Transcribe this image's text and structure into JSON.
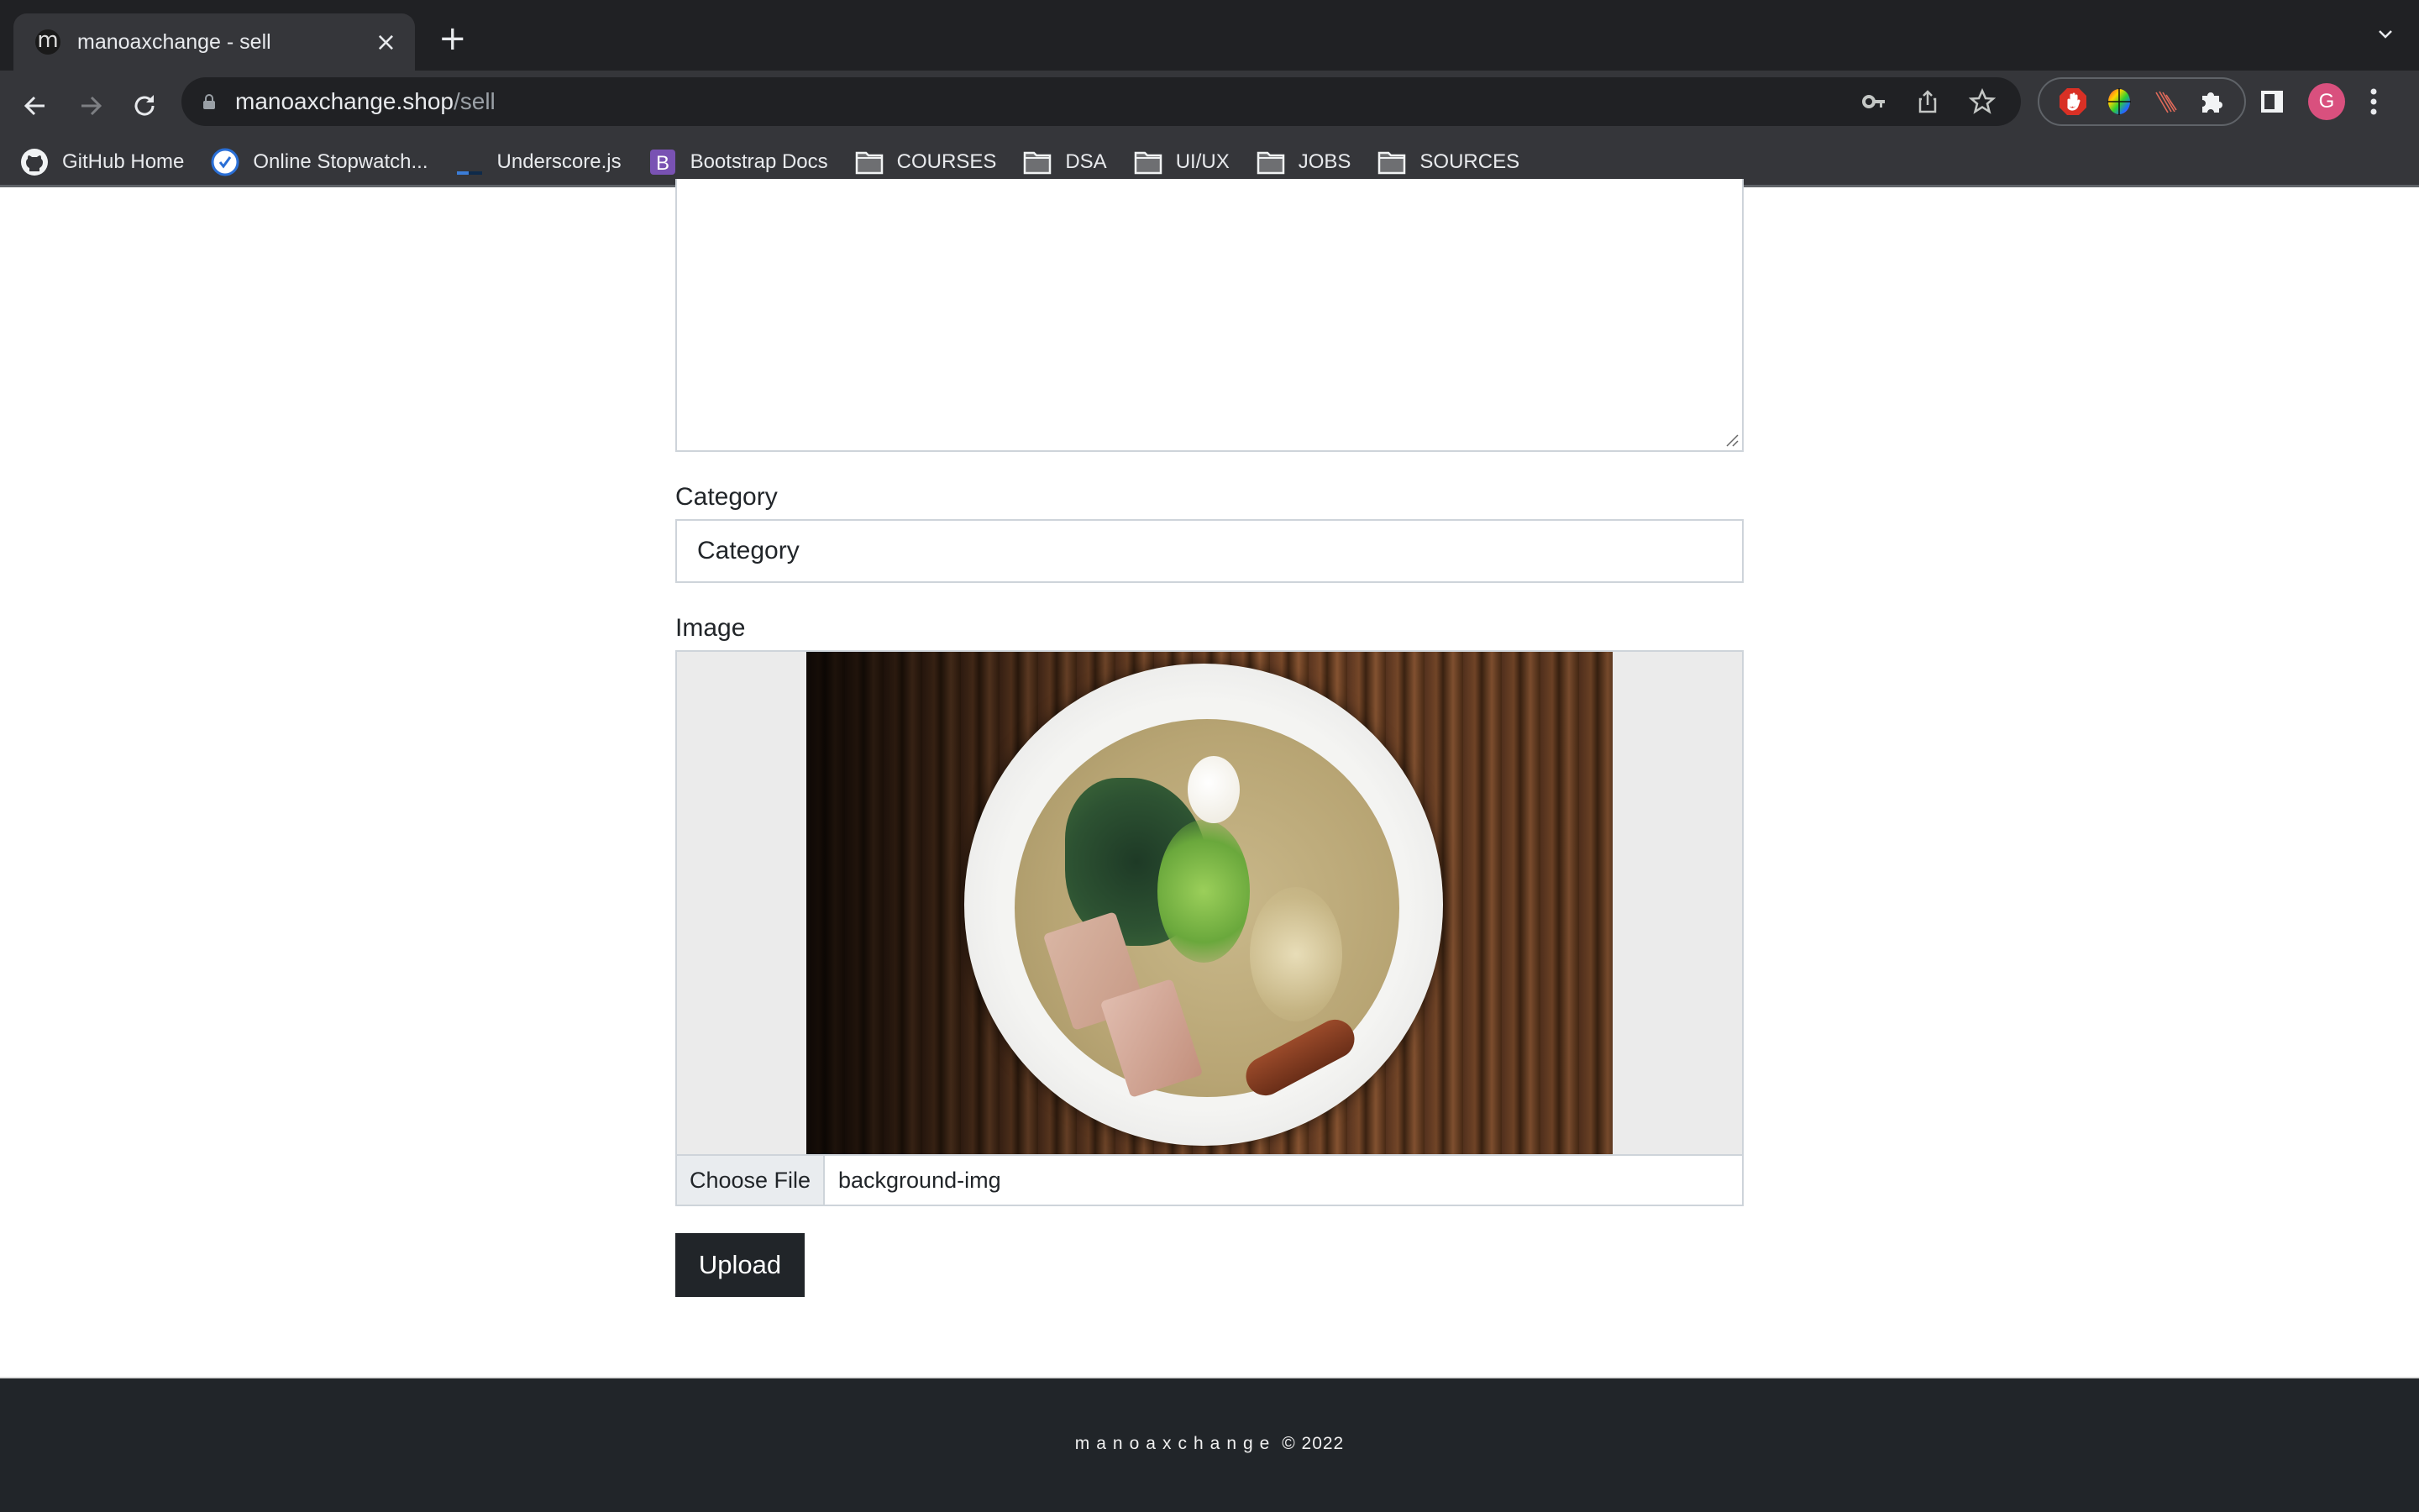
{
  "browser": {
    "tab": {
      "title": "manoaxchange - sell",
      "favicon_letter": "m",
      "close_glyph": "×"
    },
    "new_tab_glyph": "+",
    "address": {
      "domain": "manoaxchange.shop",
      "path": "/sell"
    },
    "profile_initial": "G",
    "bookmarks": [
      {
        "label": "GitHub Home",
        "icon": "github-icon"
      },
      {
        "label": "Online Stopwatch...",
        "icon": "stopwatch-icon"
      },
      {
        "label": "Underscore.js",
        "icon": "underscore-icon"
      },
      {
        "label": "Bootstrap Docs",
        "icon": "bootstrap-icon",
        "icon_letter": "B"
      },
      {
        "label": "COURSES",
        "icon": "folder-icon"
      },
      {
        "label": "DSA",
        "icon": "folder-icon"
      },
      {
        "label": "UI/UX",
        "icon": "folder-icon"
      },
      {
        "label": "JOBS",
        "icon": "folder-icon"
      },
      {
        "label": "SOURCES",
        "icon": "folder-icon"
      }
    ],
    "colors": {
      "tabstrip": "#202124",
      "toolbar": "#35363a",
      "avatar": "#d9507e",
      "bootstrap": "#7952b3"
    }
  },
  "form": {
    "description": {
      "value": ""
    },
    "category": {
      "label": "Category",
      "placeholder": "Category"
    },
    "image": {
      "label": "Image",
      "preview_alt": "Bowl of ramen on wooden table",
      "choose_file_label": "Choose File",
      "file_name": "background-img"
    },
    "upload_label": "Upload"
  },
  "footer": {
    "brand": "manoaxchange",
    "copyright": "© 2022"
  },
  "colors": {
    "primary_dark": "#212529",
    "border": "#ced4da",
    "file_btn_bg": "#e9ecef"
  }
}
